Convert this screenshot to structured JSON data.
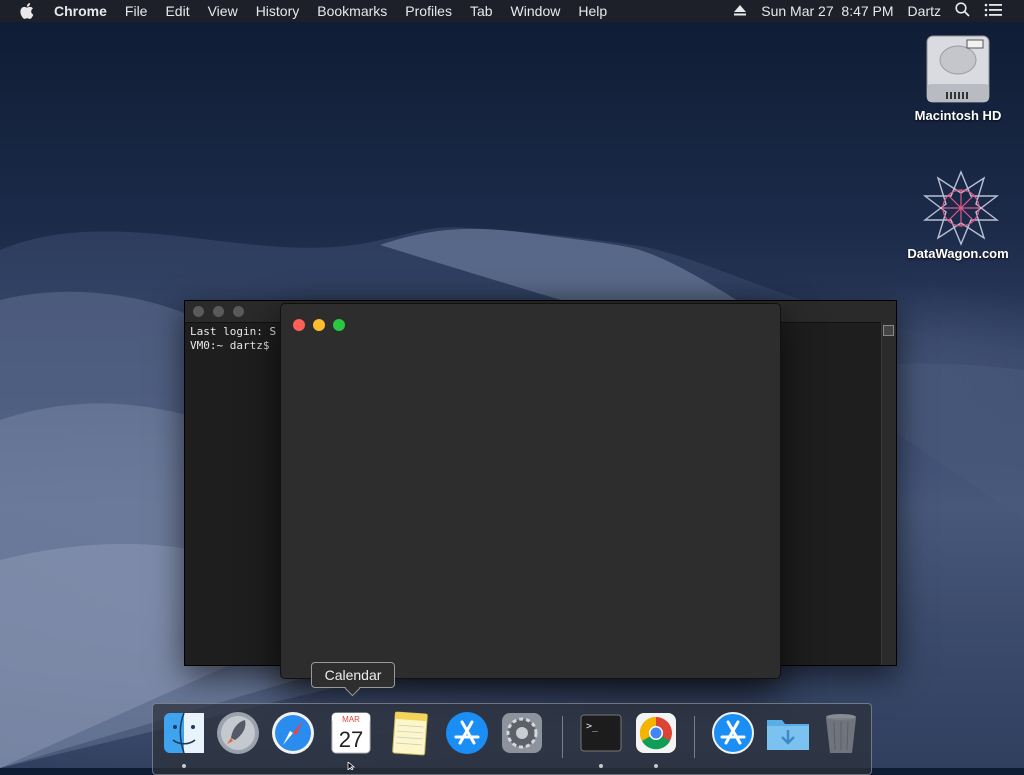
{
  "menubar": {
    "app_name": "Chrome",
    "items": [
      "File",
      "Edit",
      "View",
      "History",
      "Bookmarks",
      "Profiles",
      "Tab",
      "Window",
      "Help"
    ],
    "datetime": "Sun Mar 27  8:47 PM",
    "user": "Dartz"
  },
  "desktop": {
    "icons": [
      {
        "label": "Macintosh HD",
        "icon": "hard-drive-icon"
      },
      {
        "label": "DataWagon.com",
        "icon": "datawagon-star-icon"
      }
    ]
  },
  "terminal": {
    "line1": "Last login: S",
    "line2": "VM0:~ dartz$"
  },
  "tooltip": {
    "label": "Calendar"
  },
  "dock": {
    "calendar_month": "MAR",
    "calendar_day": "27",
    "items": [
      "Finder",
      "Launchpad",
      "Safari",
      "Calendar",
      "Notes",
      "App Store",
      "System Preferences",
      "Terminal",
      "Google Chrome",
      "App Store",
      "Downloads",
      "Trash"
    ]
  },
  "colors": {
    "close": "#ff5f57",
    "minimize": "#febc2e",
    "zoom": "#28c840",
    "menubar_bg": "#1e2028"
  }
}
